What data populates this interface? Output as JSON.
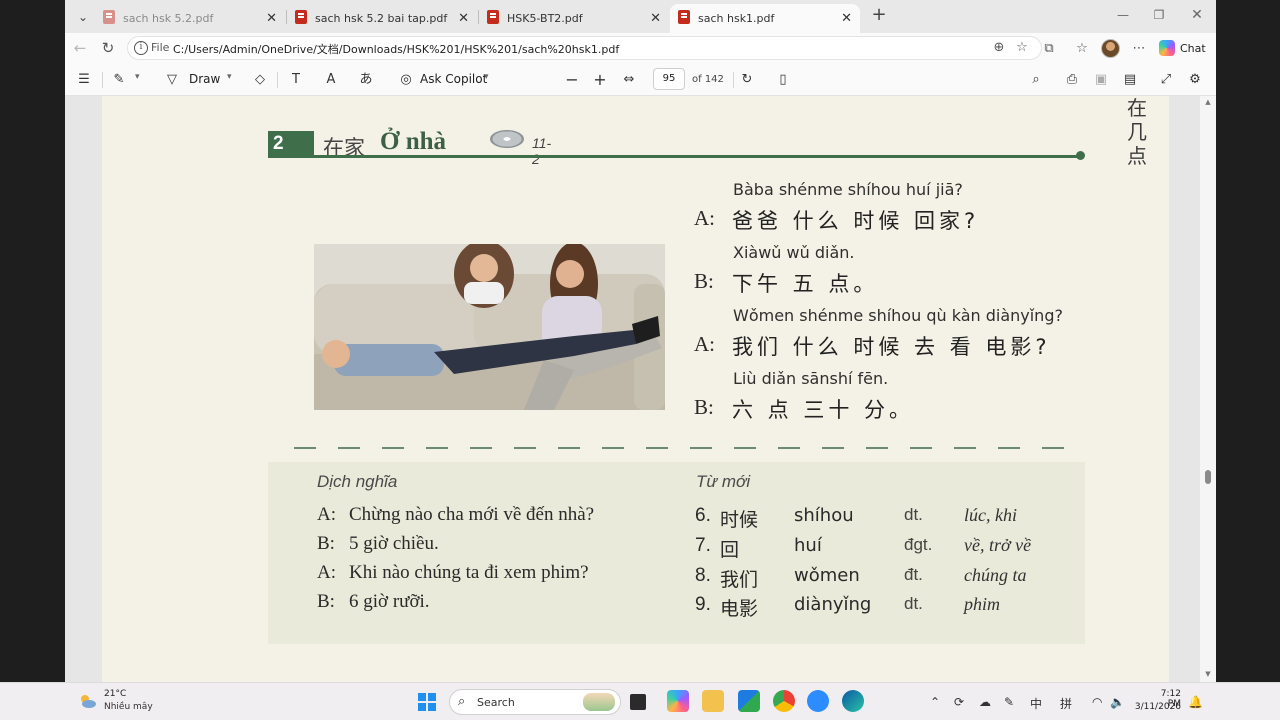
{
  "browser": {
    "tabs": [
      {
        "title": "sach hsk 5.2.pdf"
      },
      {
        "title": "sach hsk 5.2 bai tap.pdf"
      },
      {
        "title": "HSK5-BT2.pdf"
      },
      {
        "title": "sach hsk1.pdf"
      }
    ],
    "url_scheme": "File",
    "url": "C:/Users/Admin/OneDrive/文档/Downloads/HSK%201/HSK%201/sach%20hsk1.pdf",
    "chat_label": "Chat"
  },
  "pdf_toolbar": {
    "draw_label": "Draw",
    "ask_copilot_label": "Ask Copilot",
    "current_page": "95",
    "page_total": "of 142"
  },
  "page": {
    "side_title": [
      "在",
      "几",
      "点"
    ],
    "lesson_number": "2",
    "lesson_title_zh": "在家",
    "lesson_title_vi": "Ở nhà",
    "track": "11-2",
    "dialogue": [
      {
        "pinyin": "Bàba shénme shíhou huí jiā?",
        "speaker": "A:",
        "hanzi": "爸爸 什么 时候 回家?"
      },
      {
        "pinyin": "Xiàwǔ wǔ diǎn.",
        "speaker": "B:",
        "hanzi": "下午 五 点。"
      },
      {
        "pinyin": "Wǒmen shénme shíhou qù kàn diànyǐng?",
        "speaker": "A:",
        "hanzi": "我们  什么 时候 去 看  电影?"
      },
      {
        "pinyin": "Liù diǎn sānshí fēn.",
        "speaker": "B:",
        "hanzi": "六 点 三十 分。"
      }
    ],
    "translation_title": "Dịch nghĩa",
    "translation": [
      {
        "speaker": "A:",
        "text": "Chừng nào cha mới về đến nhà?"
      },
      {
        "speaker": "B:",
        "text": "5 giờ chiều."
      },
      {
        "speaker": "A:",
        "text": "Khi nào chúng ta đi xem phim?"
      },
      {
        "speaker": "B:",
        "text": "6 giờ rưỡi."
      }
    ],
    "vocab_title": "Từ mới",
    "vocab": [
      {
        "num": "6.",
        "zh": "时候",
        "py": "shíhou",
        "pos": "dt.",
        "mean": "lúc, khi"
      },
      {
        "num": "7.",
        "zh": "回",
        "py": "huí",
        "pos": "đgt.",
        "mean": "về, trở về"
      },
      {
        "num": "8.",
        "zh": "我们",
        "py": "wǒmen",
        "pos": "đt.",
        "mean": "chúng ta"
      },
      {
        "num": "9.",
        "zh": "电影",
        "py": "diànyǐng",
        "pos": "dt.",
        "mean": "phim"
      }
    ]
  },
  "taskbar": {
    "temperature": "21°C",
    "weather": "Nhiều mây",
    "search_label": "Search",
    "ime_lang": "中",
    "ime_mode": "拼",
    "time": "7:12 PM",
    "date": "3/11/2026"
  }
}
